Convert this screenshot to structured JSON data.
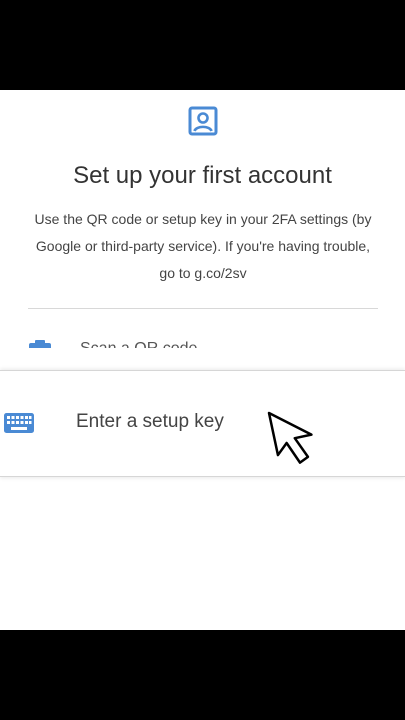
{
  "page": {
    "title": "Set up your first account",
    "description": "Use the QR code or setup key in your 2FA settings (by Google or third-party service). If you're having trouble, go to g.co/2sv"
  },
  "options": {
    "scan_qr_label": "Scan a QR code",
    "setup_key_label": "Enter a setup key"
  },
  "icons": {
    "header": "account-box-icon",
    "scan": "camera-icon",
    "setup_key": "keyboard-icon",
    "pointer": "mouse-pointer-icon"
  },
  "colors": {
    "accent": "#4a8ad4",
    "text": "#333333"
  }
}
